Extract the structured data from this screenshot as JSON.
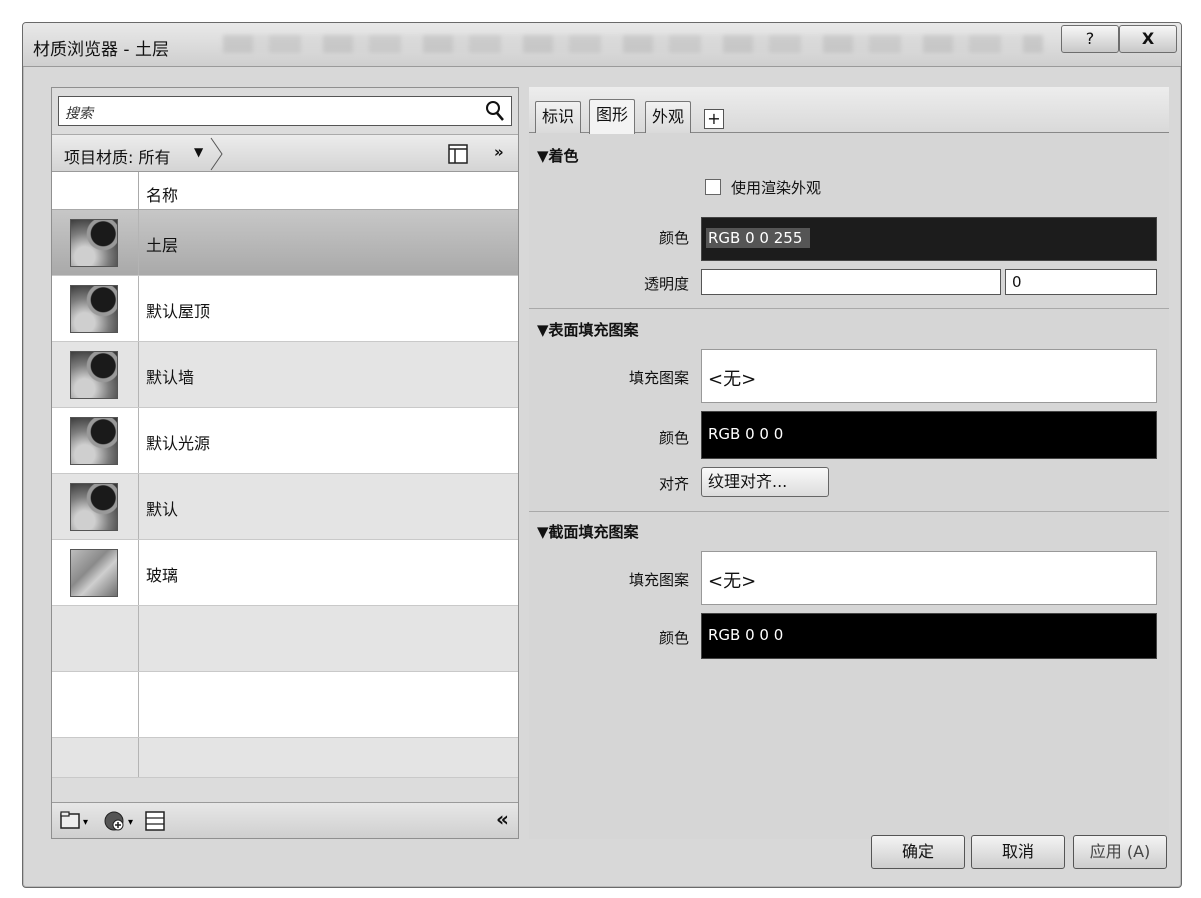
{
  "window": {
    "title": "材质浏览器 - 土层",
    "help_label": "?",
    "close_label": "X"
  },
  "left": {
    "search_placeholder": "搜索",
    "filter_label": "项目材质: 所有",
    "more_label": "»",
    "column_name": "名称",
    "materials": [
      {
        "label": "土层",
        "thumb": "sphere"
      },
      {
        "label": "默认屋顶",
        "thumb": "sphere"
      },
      {
        "label": "默认墙",
        "thumb": "sphere"
      },
      {
        "label": "默认光源",
        "thumb": "sphere"
      },
      {
        "label": "默认",
        "thumb": "sphere"
      },
      {
        "label": "玻璃",
        "thumb": "glass"
      }
    ],
    "selected_index": 0,
    "collapse_label": "«"
  },
  "right": {
    "tabs": [
      {
        "label": "标识"
      },
      {
        "label": "图形"
      },
      {
        "label": "外观"
      }
    ],
    "active_tab": 1,
    "add_tab_label": "+",
    "shading": {
      "header": "▼着色",
      "use_render_label": "使用渲染外观",
      "color_label": "颜色",
      "color_value": "RGB 0 0 255",
      "transparency_label": "透明度",
      "transparency_value": "0"
    },
    "surface": {
      "header": "▼表面填充图案",
      "pattern_label": "填充图案",
      "pattern_value": "<无>",
      "color_label": "颜色",
      "color_value": "RGB 0 0 0",
      "align_label": "对齐",
      "align_button": "纹理对齐..."
    },
    "cut": {
      "header": "▼截面填充图案",
      "pattern_label": "填充图案",
      "pattern_value": "<无>",
      "color_label": "颜色",
      "color_value": "RGB 0 0 0"
    }
  },
  "footer": {
    "ok_label": "确定",
    "cancel_label": "取消",
    "apply_label": "应用 (A)"
  }
}
